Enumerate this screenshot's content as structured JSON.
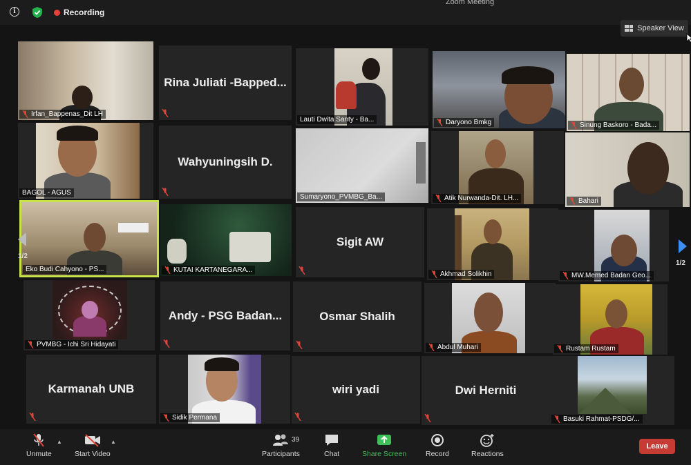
{
  "window": {
    "title": "Zoom Meeting"
  },
  "topbar": {
    "recording_label": "Recording",
    "speaker_view_label": "Speaker View"
  },
  "pagination": {
    "left": "1/2",
    "right": "1/2"
  },
  "participants": [
    {
      "name": "Irfan_Bappenas_Dit LH"
    },
    {
      "name": "Rina Juliati -Bapped..."
    },
    {
      "name": "Lauti Dwita Santy - Ba..."
    },
    {
      "name": "Daryono Bmkg"
    },
    {
      "name": "Sinung Baskoro - Bada..."
    },
    {
      "name": "BAGOL - AGUS"
    },
    {
      "name": "Wahyuningsih D."
    },
    {
      "name": "Sumaryono_PVMBG_Ba..."
    },
    {
      "name": "Atik Nurwanda-Dit. LH..."
    },
    {
      "name": "Bahari"
    },
    {
      "name": "Eko Budi Cahyono - PS..."
    },
    {
      "name": "KUTAI KARTANEGARA..."
    },
    {
      "name": "Sigit AW"
    },
    {
      "name": "Akhmad Solikhin"
    },
    {
      "name": "MW.Memed Badan Geo..."
    },
    {
      "name": "PVMBG - Ichi Sri Hidayati"
    },
    {
      "name": "Andy - PSG Badan..."
    },
    {
      "name": "Osmar Shalih"
    },
    {
      "name": "Abdul Muhari"
    },
    {
      "name": "Rustam Rustam"
    },
    {
      "name": "Karmanah UNB"
    },
    {
      "name": "Sidik Permana"
    },
    {
      "name": "wiri yadi"
    },
    {
      "name": "Dwi Herniti"
    },
    {
      "name": "Basuki Rahmat-PSDG/..."
    }
  ],
  "toolbar": {
    "unmute": "Unmute",
    "start_video": "Start Video",
    "participants": "Participants",
    "participants_count": "39",
    "chat": "Chat",
    "share_screen": "Share Screen",
    "record": "Record",
    "reactions": "Reactions",
    "leave": "Leave"
  },
  "colors": {
    "active_speaker": "#c8e44a",
    "share_green": "#3fbf5a",
    "leave_red": "#c63b33",
    "recording_red": "#e8413a"
  }
}
